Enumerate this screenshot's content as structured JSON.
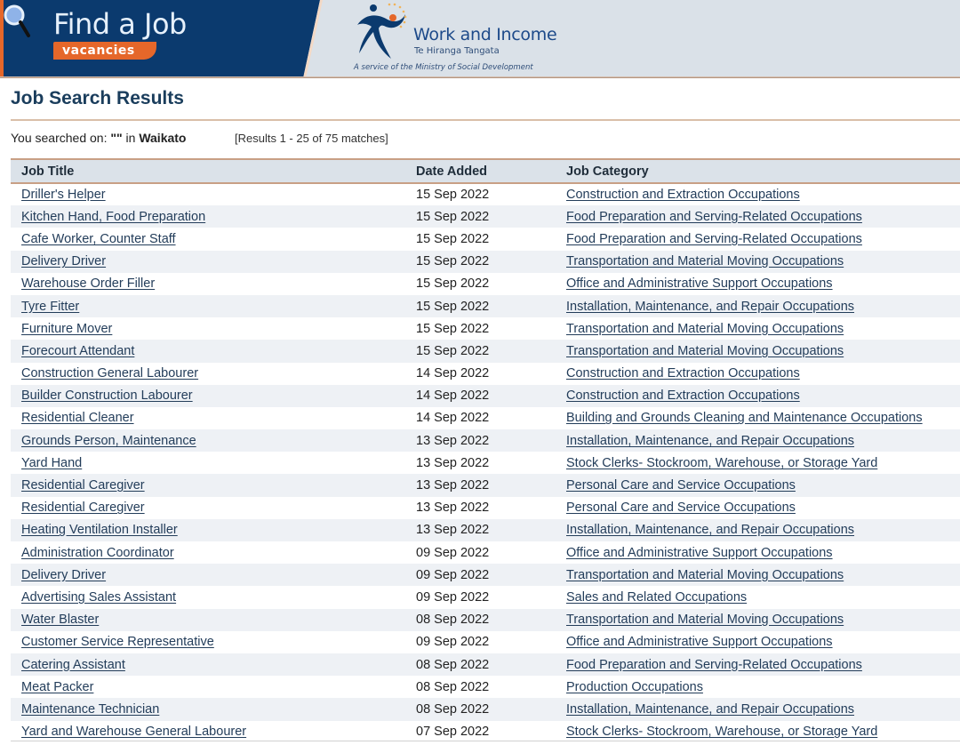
{
  "banner": {
    "find_a_job": "Find a Job",
    "vacancies": "vacancies",
    "org_name": "Work and Income",
    "org_maori_name": "Te Hiranga Tangata",
    "org_service_line": "A service of the Ministry of Social Development",
    "colors": {
      "navy": "#0b3a6e",
      "orange": "#e5672a",
      "light": "#dae1e8"
    }
  },
  "page": {
    "title": "Job Search Results",
    "search_prefix": "You searched on:",
    "search_term": "\"\"",
    "search_in": "in",
    "region": "Waikato",
    "results_count": "[Results 1 - 25 of 75 matches]"
  },
  "table": {
    "headers": {
      "job_title": "Job Title",
      "date_added": "Date Added",
      "job_category": "Job Category"
    },
    "rows": [
      {
        "title": "Driller's Helper",
        "date": "15 Sep 2022",
        "category": "Construction and Extraction Occupations"
      },
      {
        "title": "Kitchen Hand, Food Preparation",
        "date": "15 Sep 2022",
        "category": "Food Preparation and Serving-Related Occupations"
      },
      {
        "title": "Cafe Worker, Counter Staff",
        "date": "15 Sep 2022",
        "category": "Food Preparation and Serving-Related Occupations"
      },
      {
        "title": "Delivery Driver",
        "date": "15 Sep 2022",
        "category": "Transportation and Material Moving Occupations"
      },
      {
        "title": "Warehouse Order Filler",
        "date": "15 Sep 2022",
        "category": "Office and Administrative Support Occupations"
      },
      {
        "title": "Tyre Fitter",
        "date": "15 Sep 2022",
        "category": "Installation, Maintenance, and Repair Occupations"
      },
      {
        "title": "Furniture Mover",
        "date": "15 Sep 2022",
        "category": "Transportation and Material Moving Occupations"
      },
      {
        "title": "Forecourt Attendant",
        "date": "15 Sep 2022",
        "category": "Transportation and Material Moving Occupations"
      },
      {
        "title": "Construction General Labourer",
        "date": "14 Sep 2022",
        "category": "Construction and Extraction Occupations"
      },
      {
        "title": "Builder Construction Labourer",
        "date": "14 Sep 2022",
        "category": "Construction and Extraction Occupations"
      },
      {
        "title": "Residential Cleaner",
        "date": "14 Sep 2022",
        "category": "Building and Grounds Cleaning and Maintenance Occupations"
      },
      {
        "title": "Grounds Person, Maintenance",
        "date": "13 Sep 2022",
        "category": "Installation, Maintenance, and Repair Occupations"
      },
      {
        "title": "Yard Hand",
        "date": "13 Sep 2022",
        "category": "Stock Clerks- Stockroom, Warehouse, or Storage Yard"
      },
      {
        "title": "Residential Caregiver",
        "date": "13 Sep 2022",
        "category": "Personal Care and Service Occupations"
      },
      {
        "title": "Residential Caregiver",
        "date": "13 Sep 2022",
        "category": "Personal Care and Service Occupations"
      },
      {
        "title": "Heating Ventilation Installer",
        "date": "13 Sep 2022",
        "category": "Installation, Maintenance, and Repair Occupations"
      },
      {
        "title": "Administration Coordinator",
        "date": "09 Sep 2022",
        "category": "Office and Administrative Support Occupations"
      },
      {
        "title": "Delivery Driver",
        "date": "09 Sep 2022",
        "category": "Transportation and Material Moving Occupations"
      },
      {
        "title": "Advertising Sales Assistant",
        "date": "09 Sep 2022",
        "category": "Sales and Related Occupations"
      },
      {
        "title": "Water Blaster",
        "date": "08 Sep 2022",
        "category": "Transportation and Material Moving Occupations"
      },
      {
        "title": "Customer Service Representative",
        "date": "09 Sep 2022",
        "category": "Office and Administrative Support Occupations"
      },
      {
        "title": "Catering Assistant",
        "date": "08 Sep 2022",
        "category": "Food Preparation and Serving-Related Occupations"
      },
      {
        "title": "Meat Packer",
        "date": "08 Sep 2022",
        "category": "Production Occupations"
      },
      {
        "title": "Maintenance Technician",
        "date": "08 Sep 2022",
        "category": "Installation, Maintenance, and Repair Occupations"
      },
      {
        "title": "Yard and Warehouse General Labourer",
        "date": "07 Sep 2022",
        "category": "Stock Clerks- Stockroom, Warehouse, or Storage Yard"
      }
    ]
  }
}
